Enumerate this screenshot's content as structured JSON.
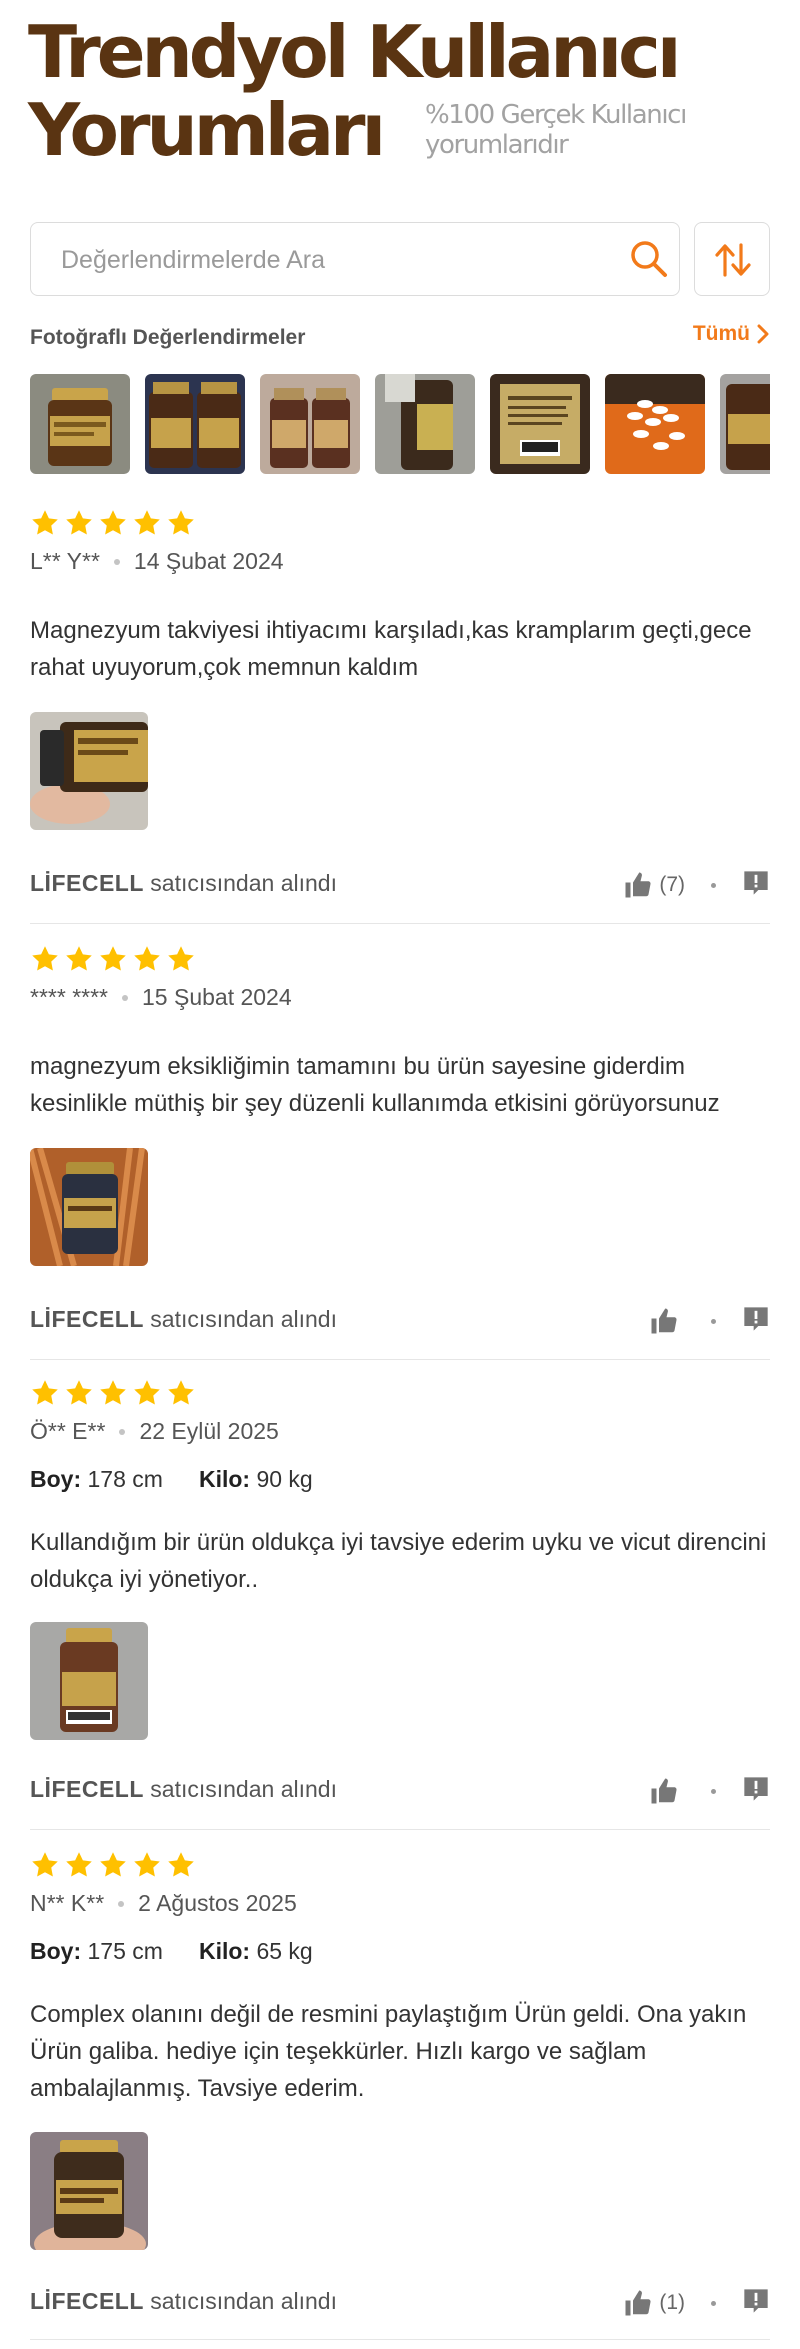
{
  "header": {
    "title_line1": "Trendyol Kullanıcı",
    "title_line2": "Yorumları",
    "subtitle": "%100 Gerçek Kullanıcı yorumlarıdır"
  },
  "search": {
    "placeholder": "Değerlendirmelerde Ara"
  },
  "photo_section": {
    "title": "Fotoğraflı Değerlendirmeler",
    "all_label": "Tümü"
  },
  "colors": {
    "brand": "#5a3412",
    "accent": "#f27a1a",
    "star": "#ffc000"
  },
  "reviews": [
    {
      "rating": 5,
      "author": "L** Y**",
      "date": "14 Şubat 2024",
      "comment": "Magnezyum takviyesi ihtiyacımı karşıladı,kas kramplarım geçti,gece rahat uyuyorum,çok memnun kaldım",
      "seller_name": "LİFECELL",
      "seller_suffix": "satıcısından alındı",
      "likes": "(7)"
    },
    {
      "rating": 5,
      "author": "**** ****",
      "date": "15 Şubat 2024",
      "comment": "magnezyum eksikliğimin tamamını bu ürün sayesine giderdim kesinlikle müthiş bir şey düzenli kullanımda etkisini görüyorsunuz",
      "seller_name": "LİFECELL",
      "seller_suffix": "satıcısından alındı",
      "likes": ""
    },
    {
      "rating": 5,
      "author": "Ö** E**",
      "date": "22 Eylül 2025",
      "height_label": "Boy:",
      "height": "178 cm",
      "weight_label": "Kilo:",
      "weight": "90 kg",
      "comment": "Kullandığım bir ürün oldukça iyi tavsiye ederim uyku ve vicut direncini oldukça iyi yönetiyor..",
      "seller_name": "LİFECELL",
      "seller_suffix": "satıcısından alındı",
      "likes": ""
    },
    {
      "rating": 5,
      "author": "N** K**",
      "date": "2 Ağustos 2025",
      "height_label": "Boy:",
      "height": "175 cm",
      "weight_label": "Kilo:",
      "weight": "65 kg",
      "comment": "Complex olanını değil de resmini paylaştığım Ürün geldi. Ona yakın Ürün galiba. hediye için teşekkürler. Hızlı kargo ve sağlam ambalajlanmış. Tavsiye ederim.",
      "seller_name": "LİFECELL",
      "seller_suffix": "satıcısından alındı",
      "likes": "(1)"
    }
  ]
}
